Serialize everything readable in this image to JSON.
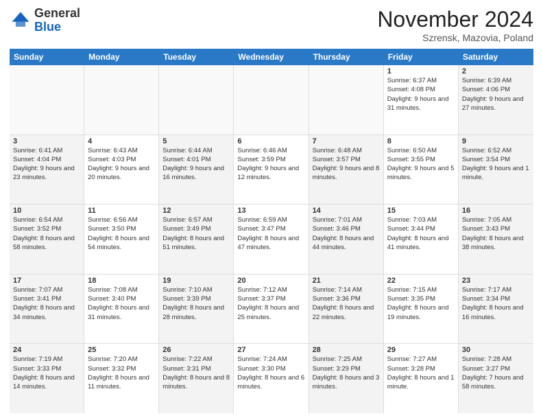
{
  "header": {
    "logo_general": "General",
    "logo_blue": "Blue",
    "month_title": "November 2024",
    "location": "Szrensk, Mazovia, Poland"
  },
  "calendar": {
    "days_of_week": [
      "Sunday",
      "Monday",
      "Tuesday",
      "Wednesday",
      "Thursday",
      "Friday",
      "Saturday"
    ],
    "weeks": [
      [
        {
          "day": "",
          "info": ""
        },
        {
          "day": "",
          "info": ""
        },
        {
          "day": "",
          "info": ""
        },
        {
          "day": "",
          "info": ""
        },
        {
          "day": "",
          "info": ""
        },
        {
          "day": "1",
          "info": "Sunrise: 6:37 AM\nSunset: 4:08 PM\nDaylight: 9 hours and 31 minutes."
        },
        {
          "day": "2",
          "info": "Sunrise: 6:39 AM\nSunset: 4:06 PM\nDaylight: 9 hours and 27 minutes."
        }
      ],
      [
        {
          "day": "3",
          "info": "Sunrise: 6:41 AM\nSunset: 4:04 PM\nDaylight: 9 hours and 23 minutes."
        },
        {
          "day": "4",
          "info": "Sunrise: 6:43 AM\nSunset: 4:03 PM\nDaylight: 9 hours and 20 minutes."
        },
        {
          "day": "5",
          "info": "Sunrise: 6:44 AM\nSunset: 4:01 PM\nDaylight: 9 hours and 16 minutes."
        },
        {
          "day": "6",
          "info": "Sunrise: 6:46 AM\nSunset: 3:59 PM\nDaylight: 9 hours and 12 minutes."
        },
        {
          "day": "7",
          "info": "Sunrise: 6:48 AM\nSunset: 3:57 PM\nDaylight: 9 hours and 8 minutes."
        },
        {
          "day": "8",
          "info": "Sunrise: 6:50 AM\nSunset: 3:55 PM\nDaylight: 9 hours and 5 minutes."
        },
        {
          "day": "9",
          "info": "Sunrise: 6:52 AM\nSunset: 3:54 PM\nDaylight: 9 hours and 1 minute."
        }
      ],
      [
        {
          "day": "10",
          "info": "Sunrise: 6:54 AM\nSunset: 3:52 PM\nDaylight: 8 hours and 58 minutes."
        },
        {
          "day": "11",
          "info": "Sunrise: 6:56 AM\nSunset: 3:50 PM\nDaylight: 8 hours and 54 minutes."
        },
        {
          "day": "12",
          "info": "Sunrise: 6:57 AM\nSunset: 3:49 PM\nDaylight: 8 hours and 51 minutes."
        },
        {
          "day": "13",
          "info": "Sunrise: 6:59 AM\nSunset: 3:47 PM\nDaylight: 8 hours and 47 minutes."
        },
        {
          "day": "14",
          "info": "Sunrise: 7:01 AM\nSunset: 3:46 PM\nDaylight: 8 hours and 44 minutes."
        },
        {
          "day": "15",
          "info": "Sunrise: 7:03 AM\nSunset: 3:44 PM\nDaylight: 8 hours and 41 minutes."
        },
        {
          "day": "16",
          "info": "Sunrise: 7:05 AM\nSunset: 3:43 PM\nDaylight: 8 hours and 38 minutes."
        }
      ],
      [
        {
          "day": "17",
          "info": "Sunrise: 7:07 AM\nSunset: 3:41 PM\nDaylight: 8 hours and 34 minutes."
        },
        {
          "day": "18",
          "info": "Sunrise: 7:08 AM\nSunset: 3:40 PM\nDaylight: 8 hours and 31 minutes."
        },
        {
          "day": "19",
          "info": "Sunrise: 7:10 AM\nSunset: 3:39 PM\nDaylight: 8 hours and 28 minutes."
        },
        {
          "day": "20",
          "info": "Sunrise: 7:12 AM\nSunset: 3:37 PM\nDaylight: 8 hours and 25 minutes."
        },
        {
          "day": "21",
          "info": "Sunrise: 7:14 AM\nSunset: 3:36 PM\nDaylight: 8 hours and 22 minutes."
        },
        {
          "day": "22",
          "info": "Sunrise: 7:15 AM\nSunset: 3:35 PM\nDaylight: 8 hours and 19 minutes."
        },
        {
          "day": "23",
          "info": "Sunrise: 7:17 AM\nSunset: 3:34 PM\nDaylight: 8 hours and 16 minutes."
        }
      ],
      [
        {
          "day": "24",
          "info": "Sunrise: 7:19 AM\nSunset: 3:33 PM\nDaylight: 8 hours and 14 minutes."
        },
        {
          "day": "25",
          "info": "Sunrise: 7:20 AM\nSunset: 3:32 PM\nDaylight: 8 hours and 11 minutes."
        },
        {
          "day": "26",
          "info": "Sunrise: 7:22 AM\nSunset: 3:31 PM\nDaylight: 8 hours and 8 minutes."
        },
        {
          "day": "27",
          "info": "Sunrise: 7:24 AM\nSunset: 3:30 PM\nDaylight: 8 hours and 6 minutes."
        },
        {
          "day": "28",
          "info": "Sunrise: 7:25 AM\nSunset: 3:29 PM\nDaylight: 8 hours and 3 minutes."
        },
        {
          "day": "29",
          "info": "Sunrise: 7:27 AM\nSunset: 3:28 PM\nDaylight: 8 hours and 1 minute."
        },
        {
          "day": "30",
          "info": "Sunrise: 7:28 AM\nSunset: 3:27 PM\nDaylight: 7 hours and 58 minutes."
        }
      ]
    ]
  }
}
